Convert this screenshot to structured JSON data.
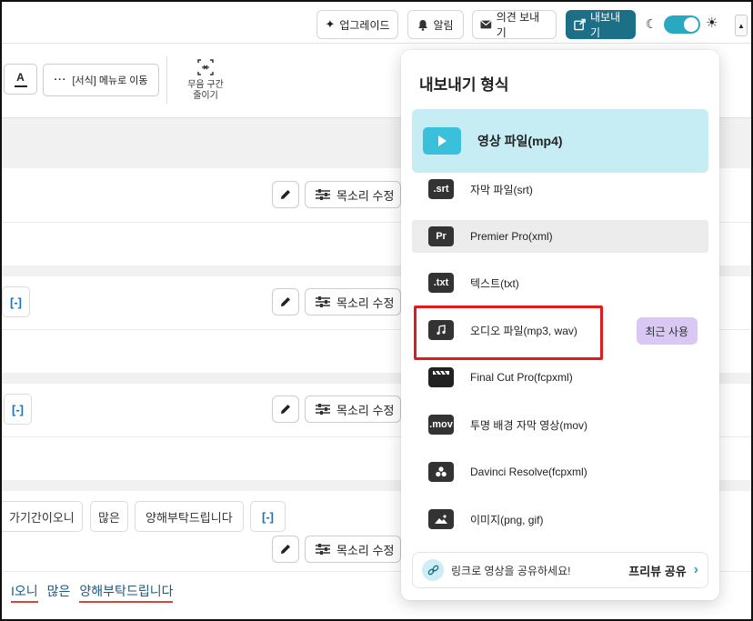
{
  "topbar": {
    "upgrade_label": "업그레이드",
    "alarm_label": "알림",
    "feedback_label": "의견 보내기",
    "export_label": "내보내기"
  },
  "toolbar": {
    "text_format_glyph": "A",
    "format_menu_label": "[서식] 메뉴로 이동",
    "silence_label_line1": "무음 구간",
    "silence_label_line2": "줄이기"
  },
  "rows": {
    "voice_edit_label": "목소리 수정",
    "bracket_chip": "[-]",
    "row4_chips": [
      "가기간이오니",
      "많은",
      "양해부탁드립니다",
      "[-]"
    ],
    "bottom_words": [
      "I오니",
      "많은",
      "양해부탁드립니다"
    ]
  },
  "export_menu": {
    "title": "내보내기 형식",
    "options": [
      {
        "icon": "play-icon",
        "label": "영상 파일(mp4)"
      },
      {
        "icon": ".srt",
        "label": "자막 파일(srt)"
      },
      {
        "icon": "Pr",
        "label": "Premier Pro(xml)"
      },
      {
        "icon": ".txt",
        "label": "텍스트(txt)"
      },
      {
        "icon": "music-note-icon",
        "label": "오디오 파일(mp3, wav)"
      },
      {
        "icon": "clapperboard-icon",
        "label": "Final Cut Pro(fcpxml)"
      },
      {
        "icon": ".mov",
        "label": "투명 배경 자막 영상(mov)"
      },
      {
        "icon": "davinci-icon",
        "label": "Davinci Resolve(fcpxml)"
      },
      {
        "icon": "image-icon",
        "label": "이미지(png, gif)"
      }
    ],
    "recent_badge": "최근 사용",
    "share_text": "링크로 영상을 공유하세요!",
    "share_cta": "프리뷰 공유"
  },
  "colors": {
    "accent": "#1b6f86",
    "highlight_video": "#c6ecf4",
    "recent_badge": "#d9c8f4",
    "annotation_red": "#e01b1b"
  }
}
